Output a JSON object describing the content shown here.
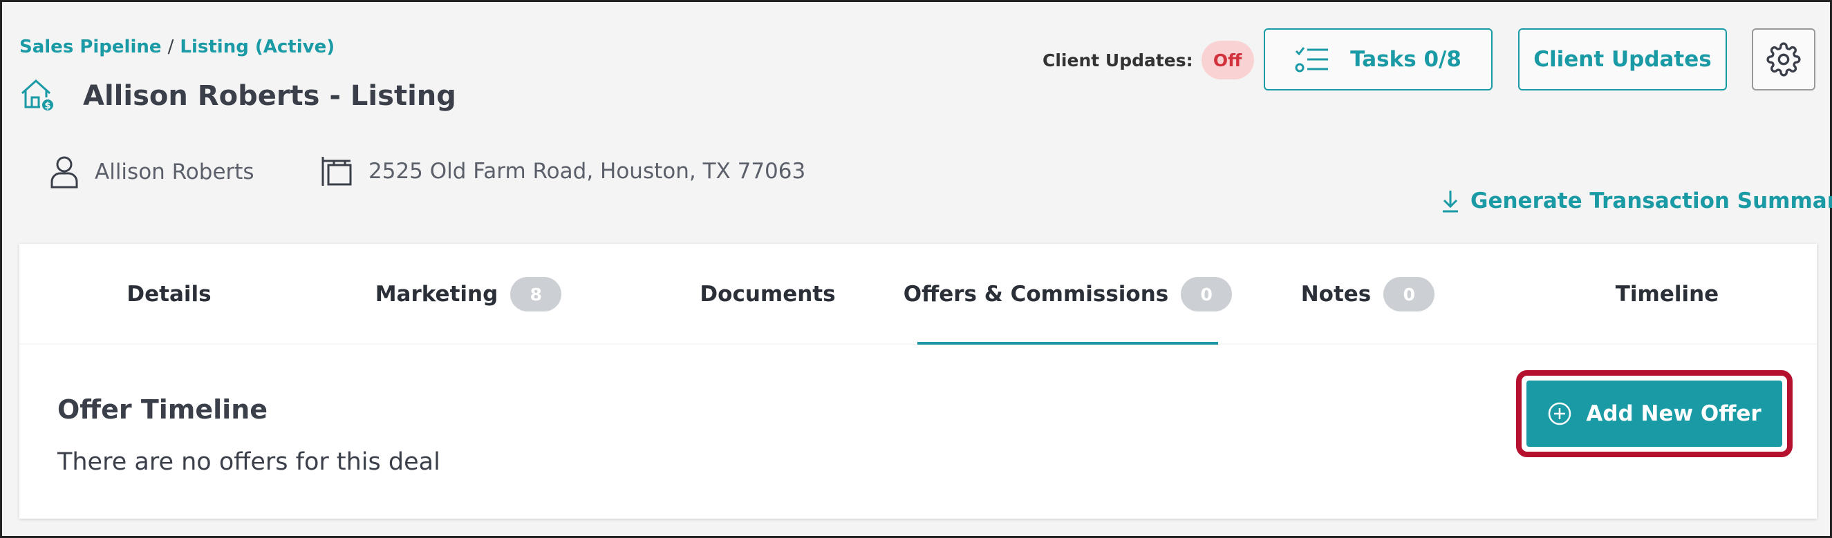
{
  "breadcrumb": {
    "pipeline": "Sales Pipeline",
    "separator": "/",
    "listing": "Listing (Active)"
  },
  "header": {
    "title": "Allison Roberts - Listing",
    "title_icon": "house-dollar-icon",
    "client_name": "Allison Roberts",
    "address": "2525 Old Farm Road, Houston, TX 77063"
  },
  "toolbar": {
    "client_updates_label": "Client Updates:",
    "client_updates_status": "Off",
    "tasks_label": "Tasks 0/8",
    "client_updates_button": "Client Updates",
    "settings_icon": "gear-icon",
    "generate_summary": "Generate Transaction Summary"
  },
  "tabs": [
    {
      "label": "Details",
      "badge": null
    },
    {
      "label": "Marketing",
      "badge": "8"
    },
    {
      "label": "Documents",
      "badge": null
    },
    {
      "label": "Offers & Commissions",
      "badge": "0"
    },
    {
      "label": "Notes",
      "badge": "0"
    },
    {
      "label": "Timeline",
      "badge": null
    }
  ],
  "active_tab": "Offers & Commissions",
  "offers": {
    "heading": "Offer Timeline",
    "empty_message": "There are no offers for this deal",
    "add_button": "Add New Offer"
  },
  "colors": {
    "accent": "#1a9aa5",
    "highlight": "#b5112e",
    "off_pill_bg": "#f9d3d3",
    "off_pill_text": "#d2323c"
  }
}
